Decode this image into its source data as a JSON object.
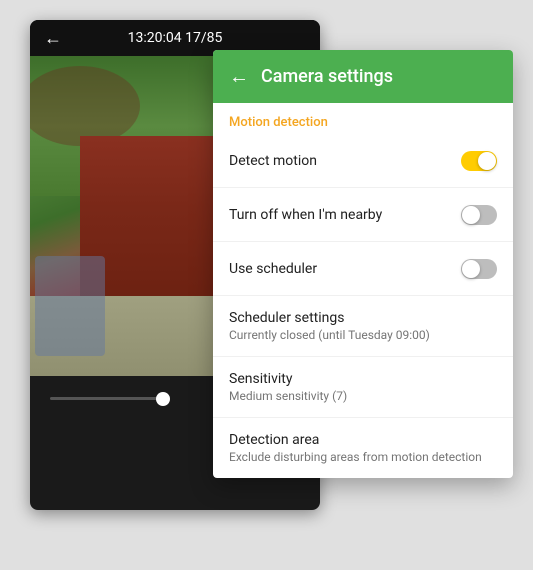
{
  "camera": {
    "back_label": "←",
    "timestamp": "13:20:04  17/85"
  },
  "controls": {
    "share_icon": "share",
    "download_icon": "download",
    "play_icon": "play"
  },
  "settings": {
    "back_label": "←",
    "title": "Camera settings",
    "section_label": "Motion detection",
    "items": [
      {
        "label": "Detect motion",
        "sublabel": "",
        "toggle": true,
        "toggle_state": "on"
      },
      {
        "label": "Turn off when I'm nearby",
        "sublabel": "",
        "toggle": true,
        "toggle_state": "off"
      },
      {
        "label": "Use scheduler",
        "sublabel": "",
        "toggle": true,
        "toggle_state": "off"
      },
      {
        "label": "Scheduler settings",
        "sublabel": "Currently closed (until Tuesday 09:00)",
        "toggle": false,
        "toggle_state": ""
      },
      {
        "label": "Sensitivity",
        "sublabel": "Medium sensitivity (7)",
        "toggle": false,
        "toggle_state": ""
      },
      {
        "label": "Detection area",
        "sublabel": "Exclude disturbing areas from motion detection",
        "toggle": false,
        "toggle_state": ""
      }
    ]
  }
}
